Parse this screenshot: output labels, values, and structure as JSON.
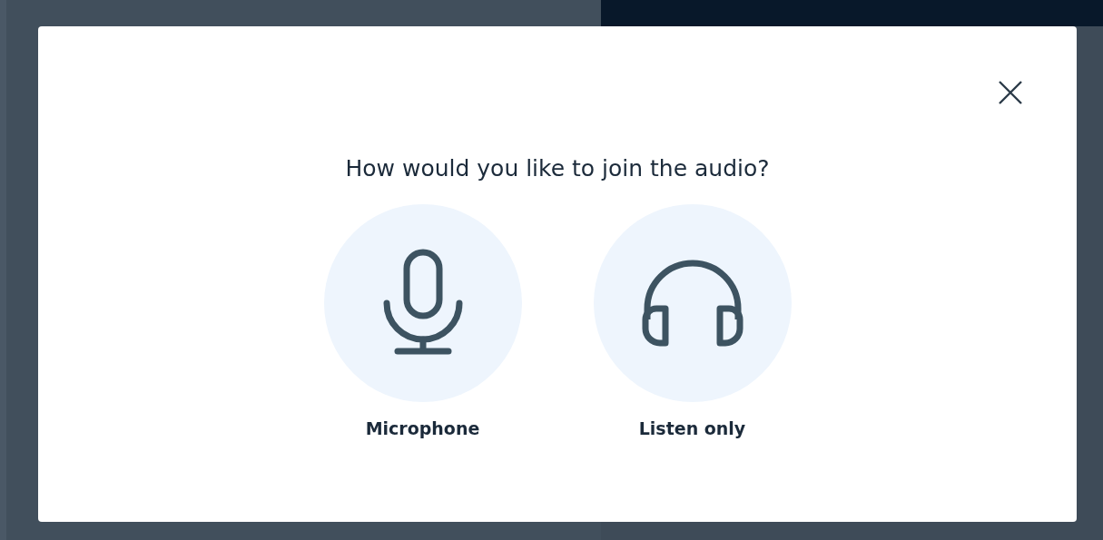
{
  "dialog": {
    "title": "How would you like to join the audio?",
    "options": [
      {
        "kind": "microphone",
        "label": "Microphone"
      },
      {
        "kind": "listen",
        "label": "Listen only"
      }
    ]
  }
}
